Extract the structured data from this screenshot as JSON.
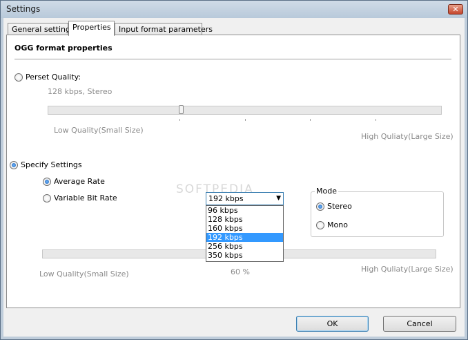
{
  "window": {
    "title": "Settings",
    "close_glyph": "✕"
  },
  "tabs": [
    {
      "label": "General settings",
      "active": false
    },
    {
      "label": "Properties",
      "active": true
    },
    {
      "label": "Input format parameters",
      "active": false
    }
  ],
  "section": {
    "title": "OGG format properties"
  },
  "preset": {
    "radio_label": "Perset Quality:",
    "selected": false,
    "current_text": "128 kbps, Stereo",
    "slider_position": 0.34,
    "low_label": "Low Quality(Small Size)",
    "high_label": "High Quliaty(Large Size)"
  },
  "specify": {
    "radio_label": "Specify Settings",
    "selected": true,
    "average_rate_label": "Average Rate",
    "average_rate_selected": true,
    "vbr_label": "Variable Bit Rate",
    "vbr_selected": false,
    "bitrate": {
      "selected": "192 kbps",
      "arrow_glyph": "▼",
      "options": [
        "96 kbps",
        "128 kbps",
        "160 kbps",
        "192 kbps",
        "256 kbps",
        "350 kbps"
      ],
      "highlighted_index": 3
    },
    "quality_slider": {
      "low_label": "Low Quality(Small Size)",
      "value_text": "60 %",
      "high_label": "High Quliaty(Large Size)"
    }
  },
  "mode": {
    "title": "Mode",
    "stereo_label": "Stereo",
    "stereo_selected": true,
    "mono_label": "Mono",
    "mono_selected": false
  },
  "watermark": "SOFTPEDIA",
  "buttons": {
    "ok": "OK",
    "cancel": "Cancel"
  }
}
